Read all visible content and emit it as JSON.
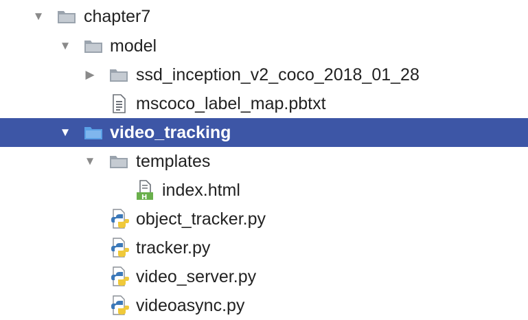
{
  "tree": {
    "items": [
      {
        "label": "chapter7",
        "icon": "folder-icon",
        "state": "expanded"
      },
      {
        "label": "model",
        "icon": "folder-icon",
        "state": "expanded"
      },
      {
        "label": "ssd_inception_v2_coco_2018_01_28",
        "icon": "folder-icon",
        "state": "collapsed"
      },
      {
        "label": "mscoco_label_map.pbtxt",
        "icon": "text-file-icon"
      },
      {
        "label": "video_tracking",
        "icon": "folder-icon",
        "state": "expanded",
        "selected": true
      },
      {
        "label": "templates",
        "icon": "folder-icon",
        "state": "expanded"
      },
      {
        "label": "index.html",
        "icon": "html-file-icon"
      },
      {
        "label": "object_tracker.py",
        "icon": "python-file-icon"
      },
      {
        "label": "tracker.py",
        "icon": "python-file-icon"
      },
      {
        "label": "video_server.py",
        "icon": "python-file-icon"
      },
      {
        "label": "videoasync.py",
        "icon": "python-file-icon"
      }
    ]
  },
  "colors": {
    "selection": "#3d56a6",
    "folder": "#9aa3ad",
    "selected_folder": "#5aa0e6",
    "text": "#222222",
    "arrow": "#8a8a8a"
  }
}
